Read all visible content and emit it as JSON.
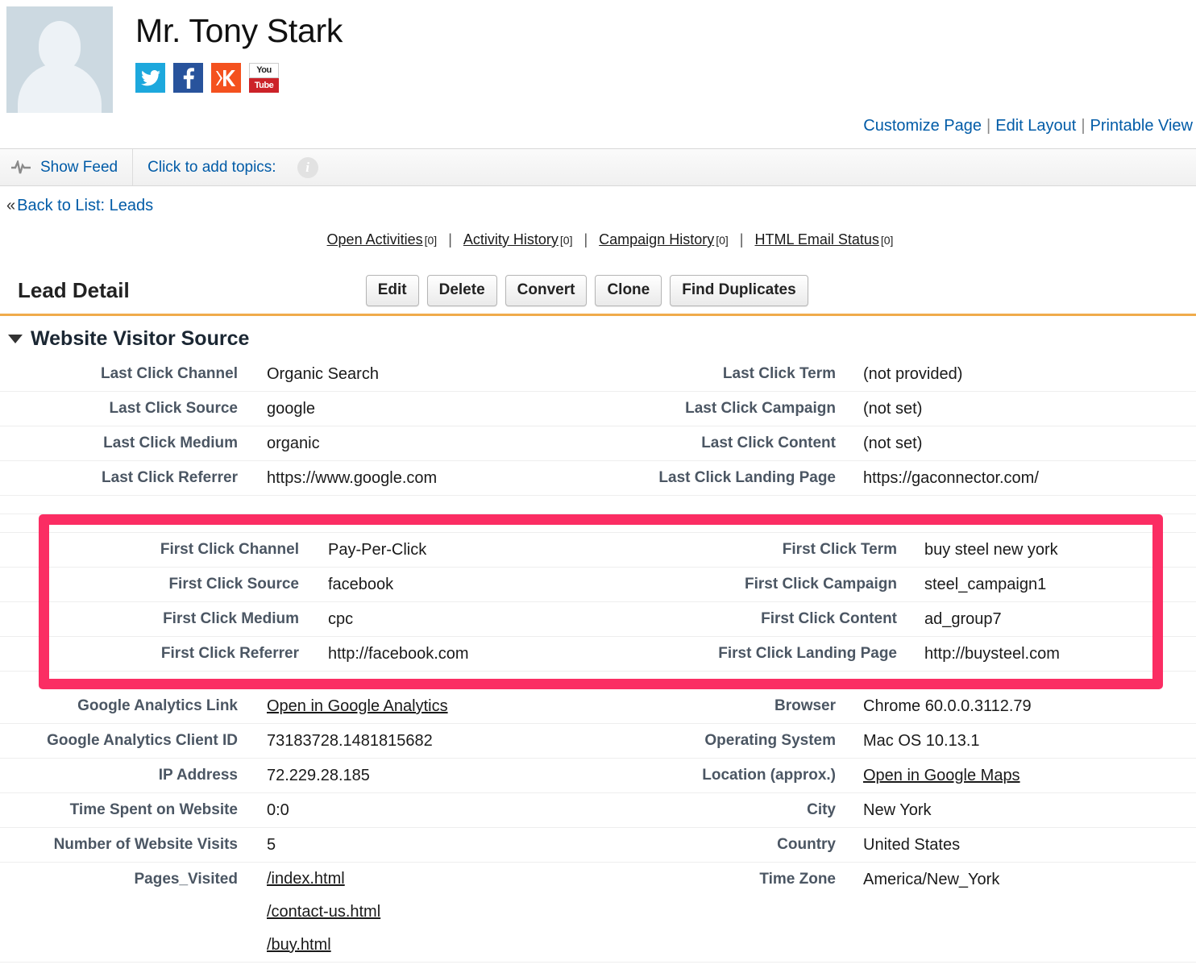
{
  "header": {
    "lead_name": "Mr. Tony Stark",
    "avatar_alt": "default-profile-photo",
    "social": [
      {
        "name": "twitter",
        "color": "#1da8dd"
      },
      {
        "name": "facebook",
        "color": "#28539c"
      },
      {
        "name": "klout",
        "color": "#f4511e"
      },
      {
        "name": "youtube",
        "color": "#cc2229",
        "line1": "You",
        "line2": "Tube"
      }
    ]
  },
  "top_links": {
    "customize_page": "Customize Page",
    "edit_layout": "Edit Layout",
    "printable_view": "Printable View",
    "separator": "|"
  },
  "feedbar": {
    "show_feed": "Show Feed",
    "add_topics": "Click to add topics:",
    "info_glyph": "i"
  },
  "back": {
    "chevron": "«",
    "label": "Back to List: Leads"
  },
  "related_nav": {
    "separator": "|",
    "items": [
      {
        "label": "Open Activities",
        "count": "[0]"
      },
      {
        "label": "Activity History",
        "count": "[0]"
      },
      {
        "label": "Campaign History",
        "count": "[0]"
      },
      {
        "label": "HTML Email Status",
        "count": "[0]"
      }
    ]
  },
  "detail": {
    "title": "Lead Detail",
    "buttons": [
      {
        "label": "Edit"
      },
      {
        "label": "Delete"
      },
      {
        "label": "Convert"
      },
      {
        "label": "Clone"
      },
      {
        "label": "Find Duplicates"
      }
    ]
  },
  "section": {
    "title": "Website Visitor Source"
  },
  "last_click": [
    {
      "label": "Last Click Channel",
      "value": "Organic Search",
      "label_r": "Last Click Term",
      "value_r": "(not provided)"
    },
    {
      "label": "Last Click Source",
      "value": "google",
      "label_r": "Last Click Campaign",
      "value_r": "(not set)"
    },
    {
      "label": "Last Click Medium",
      "value": "organic",
      "label_r": "Last Click Content",
      "value_r": "(not set)"
    },
    {
      "label": "Last Click Referrer",
      "value": "https://www.google.com",
      "label_r": "Last Click Landing Page",
      "value_r": "https://gaconnector.com/"
    }
  ],
  "first_click": [
    {
      "label": "First Click Channel",
      "value": "Pay-Per-Click",
      "label_r": "First Click Term",
      "value_r": "buy steel new york"
    },
    {
      "label": "First Click Source",
      "value": "facebook",
      "label_r": "First Click Campaign",
      "value_r": "steel_campaign1"
    },
    {
      "label": "First Click Medium",
      "value": "cpc",
      "label_r": "First Click Content",
      "value_r": "ad_group7"
    },
    {
      "label": "First Click Referrer",
      "value": "http://facebook.com",
      "label_r": "First Click Landing Page",
      "value_r": "http://buysteel.com"
    }
  ],
  "analytics": [
    {
      "label": "Google Analytics Link",
      "value": "Open in Google Analytics",
      "value_link": true,
      "label_r": "Browser",
      "value_r": "Chrome 60.0.0.3112.79",
      "value_r_link": false
    },
    {
      "label": "Google Analytics Client ID",
      "value": "73183728.1481815682",
      "value_link": false,
      "label_r": "Operating System",
      "value_r": "Mac OS 10.13.1",
      "value_r_link": false
    },
    {
      "label": "IP Address",
      "value": "72.229.28.185",
      "value_link": false,
      "label_r": "Location (approx.)",
      "value_r": "Open in Google Maps",
      "value_r_link": true
    },
    {
      "label": "Time Spent on Website",
      "value": "0:0",
      "value_link": false,
      "label_r": "City",
      "value_r": "New York",
      "value_r_link": false
    },
    {
      "label": "Number of Website Visits",
      "value": "5",
      "value_link": false,
      "label_r": "Country",
      "value_r": "United States",
      "value_r_link": false
    }
  ],
  "pages_visited": {
    "label": "Pages_Visited",
    "pages": [
      "/index.html",
      "/contact-us.html",
      "/buy.html"
    ],
    "label_r": "Time Zone",
    "value_r": "America/New_York"
  },
  "colors": {
    "link_blue": "#015ba7",
    "highlight_pink": "#fb2d63",
    "section_rule_orange": "#f0ab4b",
    "label_gray": "#4b5663"
  }
}
